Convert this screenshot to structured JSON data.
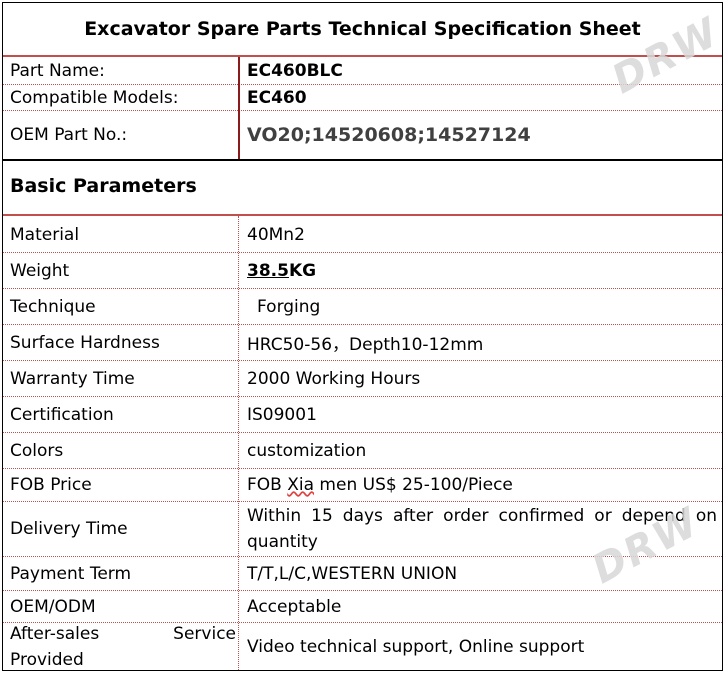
{
  "title": "Excavator Spare Parts Technical Specification Sheet",
  "header_rows": [
    {
      "label": "Part Name:",
      "value": "EC460BLC"
    },
    {
      "label": "Compatible Models:",
      "value": "EC460"
    },
    {
      "label": "OEM Part No.:",
      "value": "VO20;14520608;14527124"
    }
  ],
  "section_title": "Basic Parameters",
  "params": [
    {
      "label": "Material",
      "value": "40Mn2"
    },
    {
      "label": "Weight",
      "value_a": "38.5",
      "value_b": "KG"
    },
    {
      "label": "Technique",
      "value": "Forging"
    },
    {
      "label": "Surface Hardness",
      "value": "HRC50-56，Depth10-12mm"
    },
    {
      "label": "Warranty Time",
      "value": "2000 Working Hours"
    },
    {
      "label": "Certification",
      "value": "IS09001"
    },
    {
      "label": "Colors",
      "value": "customization"
    },
    {
      "label": "FOB Price",
      "value_a": "FOB ",
      "value_b": "Xia",
      "value_c": " men US$ 25-100/Piece"
    },
    {
      "label": "Delivery Time",
      "value_line1": "Within 15 days after order confirmed or depend on",
      "value_line2": "quantity"
    },
    {
      "label": "Payment Term",
      "value": "T/T,L/C,WESTERN UNION"
    },
    {
      "label": "OEM/ODM",
      "value": "Acceptable"
    },
    {
      "label_line1": "After-sales Service",
      "label_line2": "Provided",
      "value": "Video technical support, Online support"
    }
  ],
  "watermark": "DRW"
}
